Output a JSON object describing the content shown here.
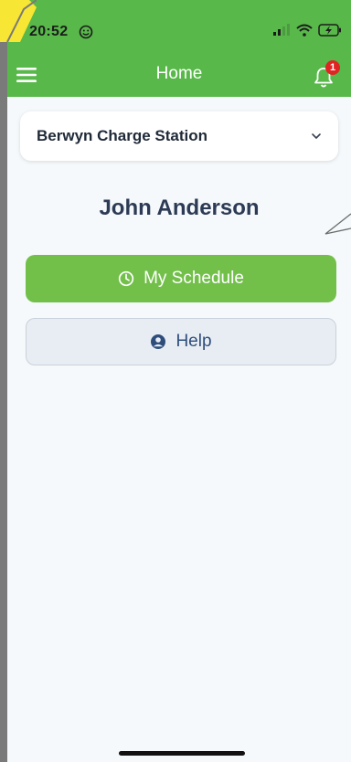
{
  "status_bar": {
    "time": "20:52",
    "smile_icon": "face-icon",
    "signal_icon": "signal-icon",
    "wifi_icon": "wifi-icon",
    "battery_icon": "battery-charging-icon"
  },
  "header": {
    "title": "Home",
    "menu_icon": "hamburger-menu-icon",
    "bell_icon": "bell-icon",
    "notification_count": "1",
    "background_color": "#58b84a"
  },
  "station_select": {
    "selected": "Berwyn Charge Station",
    "chevron_icon": "chevron-down-icon"
  },
  "user": {
    "name": "John Anderson"
  },
  "buttons": {
    "schedule_label": "My Schedule",
    "schedule_icon": "clock-icon",
    "schedule_color": "#72c04a",
    "help_label": "Help",
    "help_icon": "user-circle-icon",
    "help_color": "#e8edf4"
  }
}
